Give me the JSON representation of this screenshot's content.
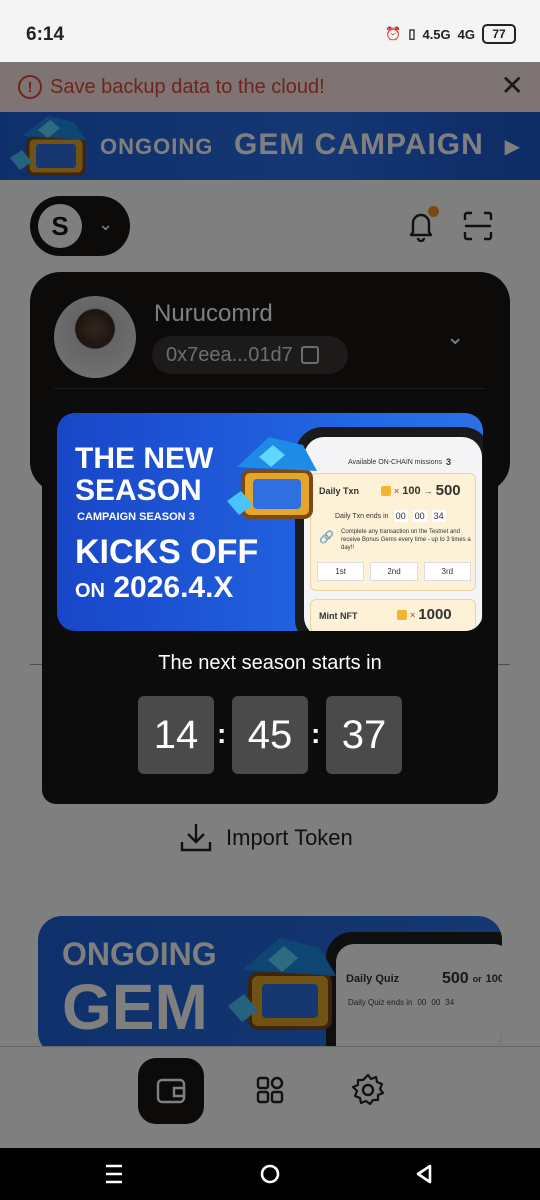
{
  "status_bar": {
    "time": "6:14",
    "network1": "4.5G",
    "network2": "4G",
    "battery": "77"
  },
  "backup_banner": {
    "text": "Save backup data to the cloud!"
  },
  "gem_banner": {
    "text_small": "ONGOING",
    "text_big": "GEM CAMPAIGN"
  },
  "wallet": {
    "name": "Nurucomrd",
    "address": "0x7eea...01d7"
  },
  "import_token": {
    "label": "Import Token"
  },
  "promo_card": {
    "line1": "ONGOING",
    "line2": "GEM",
    "quiz_label": "Daily Quiz",
    "quiz_value": "500",
    "quiz_or": "or",
    "quiz_alt": "100",
    "quiz_ends": "Daily Quiz ends in",
    "quiz_t1": "00",
    "quiz_t2": "00",
    "quiz_t3": "34"
  },
  "modal": {
    "promo": {
      "title_line1": "THE NEW",
      "title_line2": "SEASON",
      "subtitle": "CAMPAIGN SEASON 3",
      "kicks": "KICKS OFF",
      "on": "ON",
      "date": "2026.4.X",
      "phone": {
        "missions_label": "Available ON-CHAIN missions",
        "missions_count": "3",
        "txn_label": "Daily Txn",
        "txn_mult": "100",
        "txn_value": "500",
        "txn_ends": "Daily Txn ends in",
        "t1": "00",
        "t2": "00",
        "t3": "34",
        "desc": "Complete any transaction on the Testnet and receive Bonus Gems every time - up to 3 times a day!!",
        "tier1": "1st",
        "tier2": "2nd",
        "tier3": "3rd",
        "mint_label": "Mint NFT",
        "mint_value": "1000"
      }
    },
    "countdown_title": "The next season starts in",
    "hours": "14",
    "minutes": "45",
    "seconds": "37"
  }
}
